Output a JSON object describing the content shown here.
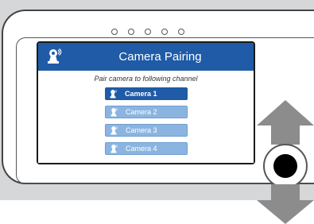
{
  "screen": {
    "title": "Camera Pairing",
    "title_icon": "camera-icon",
    "subtitle": "Pair camera to following channel"
  },
  "channels": [
    {
      "label": "Camera 1",
      "icon": "camera-icon",
      "selected": true
    },
    {
      "label": "Camera 2",
      "icon": "camera-icon",
      "selected": false
    },
    {
      "label": "Camera 3",
      "icon": "camera-icon",
      "selected": false
    },
    {
      "label": "Camera 4",
      "icon": "camera-icon",
      "selected": false
    }
  ],
  "hardware": {
    "indicator_leds": 5,
    "controls": [
      "up-arrow-icon",
      "control-knob",
      "down-arrow-icon"
    ]
  },
  "colors": {
    "accent": "#1f5ba6",
    "inactive": "#8bb5e0",
    "arrow": "#8c8c8c"
  }
}
